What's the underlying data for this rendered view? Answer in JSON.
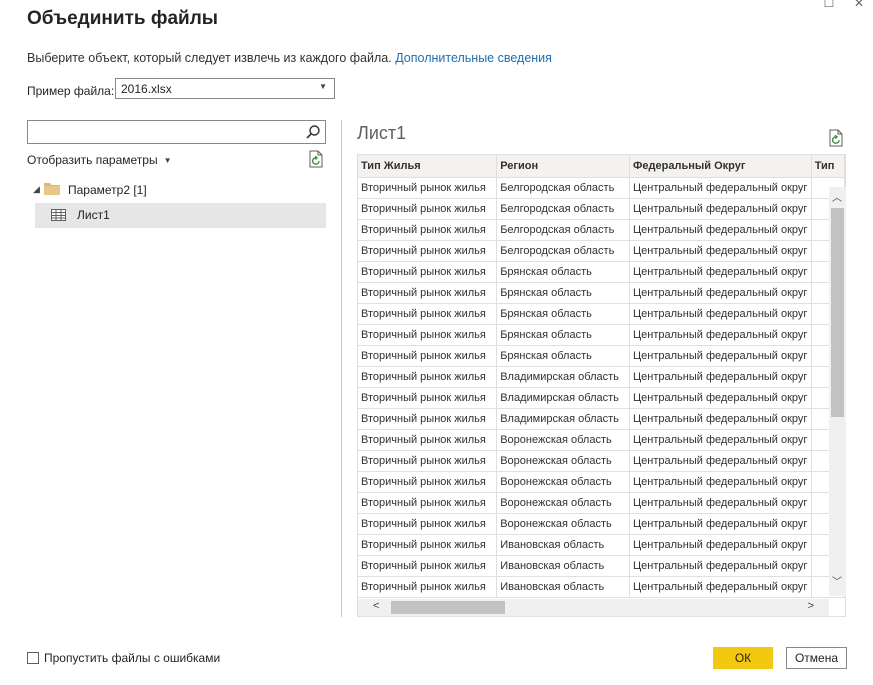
{
  "window": {
    "title": "Объединить файлы",
    "maximize_glyph": "☐",
    "close_glyph": "✕"
  },
  "subtitle": {
    "text": "Выберите объект, который следует извлечь из каждого файла.",
    "link": "Дополнительные сведения"
  },
  "sample_file": {
    "label": "Пример файла:",
    "value": "2016.xlsx"
  },
  "navigator": {
    "search_placeholder": "",
    "display_params": "Отобразить параметры",
    "tree": {
      "folder_label": "Параметр2 [1]",
      "sheet_label": "Лист1"
    }
  },
  "preview": {
    "title": "Лист1",
    "columns": [
      "Тип Жилья",
      "Регион",
      "Федеральный Округ",
      "Тип"
    ],
    "rows": [
      [
        "Вторичный рынок жилья",
        "Белгородская область",
        "Центральный федеральный округ"
      ],
      [
        "Вторичный рынок жилья",
        "Белгородская область",
        "Центральный федеральный округ"
      ],
      [
        "Вторичный рынок жилья",
        "Белгородская область",
        "Центральный федеральный округ"
      ],
      [
        "Вторичный рынок жилья",
        "Белгородская область",
        "Центральный федеральный округ"
      ],
      [
        "Вторичный рынок жилья",
        "Брянская область",
        "Центральный федеральный округ"
      ],
      [
        "Вторичный рынок жилья",
        "Брянская область",
        "Центральный федеральный округ"
      ],
      [
        "Вторичный рынок жилья",
        "Брянская область",
        "Центральный федеральный округ"
      ],
      [
        "Вторичный рынок жилья",
        "Брянская область",
        "Центральный федеральный округ"
      ],
      [
        "Вторичный рынок жилья",
        "Брянская область",
        "Центральный федеральный округ"
      ],
      [
        "Вторичный рынок жилья",
        "Владимирская область",
        "Центральный федеральный округ"
      ],
      [
        "Вторичный рынок жилья",
        "Владимирская область",
        "Центральный федеральный округ"
      ],
      [
        "Вторичный рынок жилья",
        "Владимирская область",
        "Центральный федеральный округ"
      ],
      [
        "Вторичный рынок жилья",
        "Воронежская область",
        "Центральный федеральный округ"
      ],
      [
        "Вторичный рынок жилья",
        "Воронежская область",
        "Центральный федеральный округ"
      ],
      [
        "Вторичный рынок жилья",
        "Воронежская область",
        "Центральный федеральный округ"
      ],
      [
        "Вторичный рынок жилья",
        "Воронежская область",
        "Центральный федеральный округ"
      ],
      [
        "Вторичный рынок жилья",
        "Воронежская область",
        "Центральный федеральный округ"
      ],
      [
        "Вторичный рынок жилья",
        "Ивановская область",
        "Центральный федеральный округ"
      ],
      [
        "Вторичный рынок жилья",
        "Ивановская область",
        "Центральный федеральный округ"
      ],
      [
        "Вторичный рынок жилья",
        "Ивановская область",
        "Центральный федеральный округ"
      ]
    ]
  },
  "footer": {
    "skip_errors_label": "Пропустить файлы с ошибками",
    "skip_errors_checked": false,
    "ok_label": "ОК",
    "cancel_label": "Отмена"
  },
  "colors": {
    "accent": "#f2c811",
    "link": "#1f6db5",
    "selection": "#e6e6e6"
  },
  "icons": {
    "search": "search-icon",
    "refresh": "refresh-icon",
    "folder": "folder-icon",
    "sheet": "table-icon"
  }
}
